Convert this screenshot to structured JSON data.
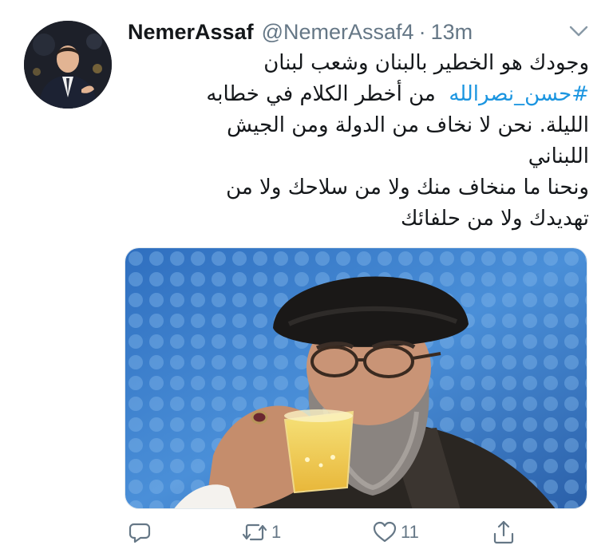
{
  "tweet": {
    "author": {
      "display_name": "NemerAssaf",
      "handle": "@NemerAssaf4",
      "separator": "·",
      "time": "13m"
    },
    "text_lines": [
      "وجودك هو الخطير بالبنان وشعب لبنان",
      "من أخطر الكلام في خطابه",
      "الليلة. نحن لا نخاف من الدولة ومن الجيش",
      "اللبناني",
      "ونحنا ما منخاف منك ولا من سلاحك ولا من",
      "تهديدك ولا من حلفائك"
    ],
    "hashtag": "#حسن_نصرالله",
    "actions": {
      "reply_icon": "reply-icon",
      "retweet_icon": "retweet-icon",
      "retweet_count": "1",
      "like_icon": "heart-icon",
      "like_count": "11",
      "share_icon": "share-icon"
    },
    "colors": {
      "accent": "#1b95e0",
      "muted": "#657786",
      "text": "#14171a"
    }
  }
}
